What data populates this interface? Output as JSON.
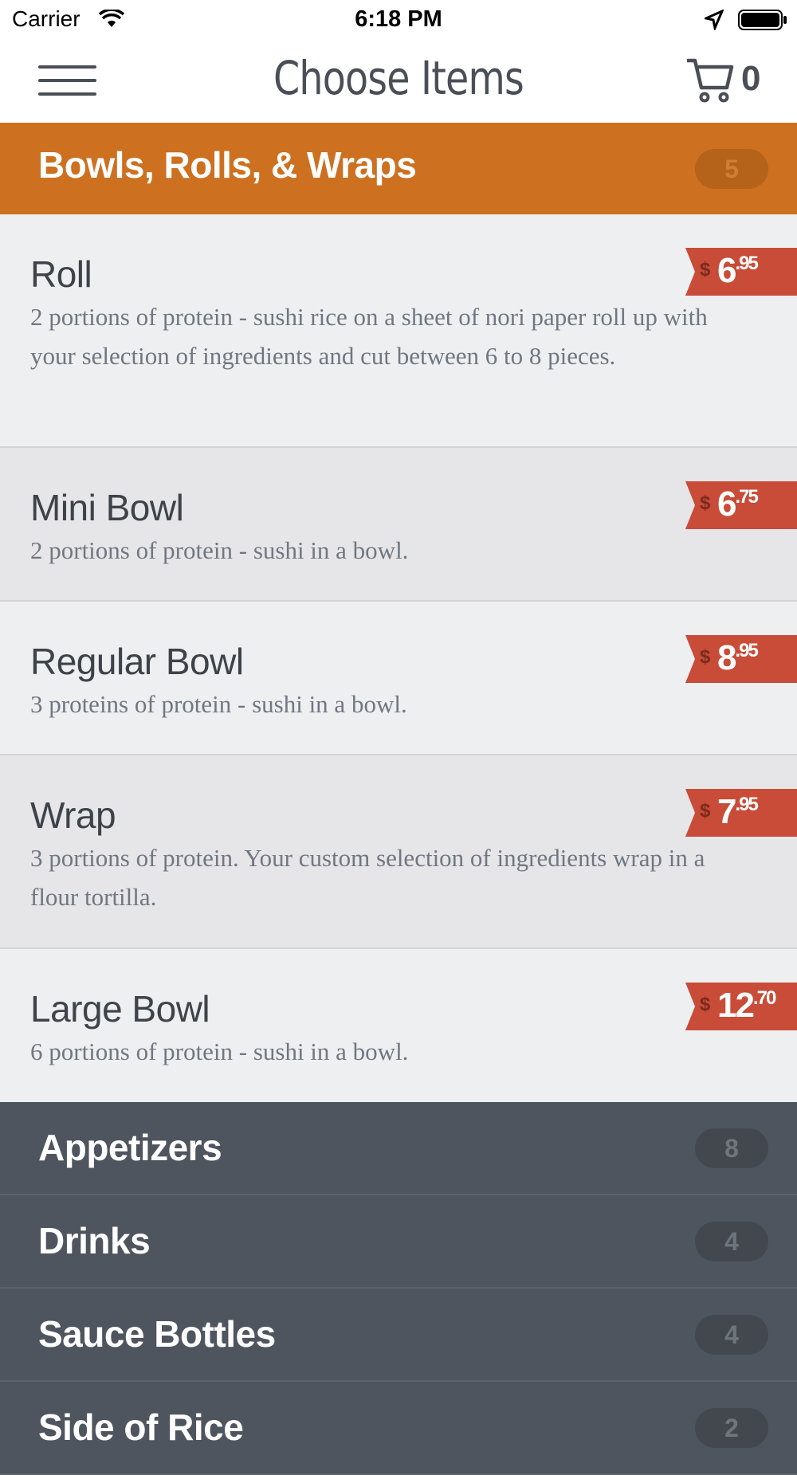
{
  "status_bar": {
    "carrier": "Carrier",
    "time": "6:18 PM"
  },
  "header": {
    "title": "Choose Items",
    "cart_count": "0"
  },
  "active_section": {
    "title": "Bowls, Rolls, & Wraps",
    "count": "5"
  },
  "items": [
    {
      "name": "Roll",
      "description": "2 portions of protein - sushi rice on a sheet of nori paper roll up with your selection of ingredients and cut between 6 to 8 pieces.",
      "currency": "$",
      "dollars": "6",
      "cents": ".95"
    },
    {
      "name": "Mini Bowl",
      "description": "2 portions of protein - sushi in a bowl.",
      "currency": "$",
      "dollars": "6",
      "cents": ".75"
    },
    {
      "name": "Regular Bowl",
      "description": "3 proteins of protein - sushi in a bowl.",
      "currency": "$",
      "dollars": "8",
      "cents": ".95"
    },
    {
      "name": "Wrap",
      "description": "3 portions of protein.  Your custom selection of ingredients wrap in a flour tortilla.",
      "currency": "$",
      "dollars": "7",
      "cents": ".95"
    },
    {
      "name": "Large Bowl",
      "description": "6 portions of protein - sushi in a bowl.",
      "currency": "$",
      "dollars": "12",
      "cents": ".70"
    }
  ],
  "categories": [
    {
      "title": "Appetizers",
      "count": "8"
    },
    {
      "title": "Drinks",
      "count": "4"
    },
    {
      "title": "Sauce Bottles",
      "count": "4"
    },
    {
      "title": "Side of Rice",
      "count": "2"
    }
  ],
  "colors": {
    "accent": "#cd701f",
    "price": "#c84c38",
    "category_bg": "#4f555e"
  }
}
